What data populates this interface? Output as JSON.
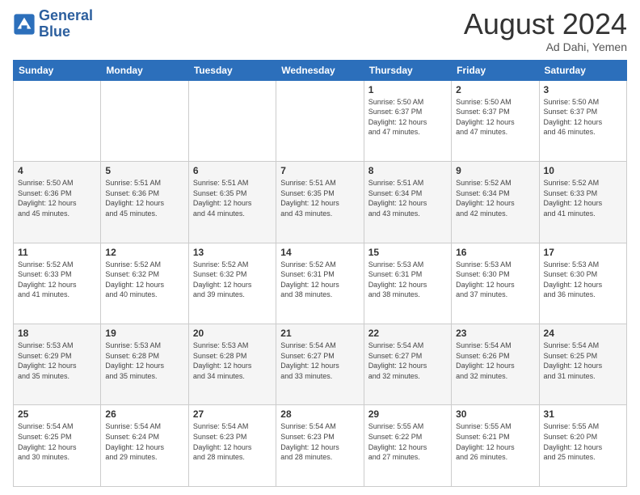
{
  "header": {
    "logo_line1": "General",
    "logo_line2": "Blue",
    "month_year": "August 2024",
    "location": "Ad Dahi, Yemen"
  },
  "days_of_week": [
    "Sunday",
    "Monday",
    "Tuesday",
    "Wednesday",
    "Thursday",
    "Friday",
    "Saturday"
  ],
  "weeks": [
    [
      {
        "day": "",
        "info": ""
      },
      {
        "day": "",
        "info": ""
      },
      {
        "day": "",
        "info": ""
      },
      {
        "day": "",
        "info": ""
      },
      {
        "day": "1",
        "info": "Sunrise: 5:50 AM\nSunset: 6:37 PM\nDaylight: 12 hours\nand 47 minutes."
      },
      {
        "day": "2",
        "info": "Sunrise: 5:50 AM\nSunset: 6:37 PM\nDaylight: 12 hours\nand 47 minutes."
      },
      {
        "day": "3",
        "info": "Sunrise: 5:50 AM\nSunset: 6:37 PM\nDaylight: 12 hours\nand 46 minutes."
      }
    ],
    [
      {
        "day": "4",
        "info": "Sunrise: 5:50 AM\nSunset: 6:36 PM\nDaylight: 12 hours\nand 45 minutes."
      },
      {
        "day": "5",
        "info": "Sunrise: 5:51 AM\nSunset: 6:36 PM\nDaylight: 12 hours\nand 45 minutes."
      },
      {
        "day": "6",
        "info": "Sunrise: 5:51 AM\nSunset: 6:35 PM\nDaylight: 12 hours\nand 44 minutes."
      },
      {
        "day": "7",
        "info": "Sunrise: 5:51 AM\nSunset: 6:35 PM\nDaylight: 12 hours\nand 43 minutes."
      },
      {
        "day": "8",
        "info": "Sunrise: 5:51 AM\nSunset: 6:34 PM\nDaylight: 12 hours\nand 43 minutes."
      },
      {
        "day": "9",
        "info": "Sunrise: 5:52 AM\nSunset: 6:34 PM\nDaylight: 12 hours\nand 42 minutes."
      },
      {
        "day": "10",
        "info": "Sunrise: 5:52 AM\nSunset: 6:33 PM\nDaylight: 12 hours\nand 41 minutes."
      }
    ],
    [
      {
        "day": "11",
        "info": "Sunrise: 5:52 AM\nSunset: 6:33 PM\nDaylight: 12 hours\nand 41 minutes."
      },
      {
        "day": "12",
        "info": "Sunrise: 5:52 AM\nSunset: 6:32 PM\nDaylight: 12 hours\nand 40 minutes."
      },
      {
        "day": "13",
        "info": "Sunrise: 5:52 AM\nSunset: 6:32 PM\nDaylight: 12 hours\nand 39 minutes."
      },
      {
        "day": "14",
        "info": "Sunrise: 5:52 AM\nSunset: 6:31 PM\nDaylight: 12 hours\nand 38 minutes."
      },
      {
        "day": "15",
        "info": "Sunrise: 5:53 AM\nSunset: 6:31 PM\nDaylight: 12 hours\nand 38 minutes."
      },
      {
        "day": "16",
        "info": "Sunrise: 5:53 AM\nSunset: 6:30 PM\nDaylight: 12 hours\nand 37 minutes."
      },
      {
        "day": "17",
        "info": "Sunrise: 5:53 AM\nSunset: 6:30 PM\nDaylight: 12 hours\nand 36 minutes."
      }
    ],
    [
      {
        "day": "18",
        "info": "Sunrise: 5:53 AM\nSunset: 6:29 PM\nDaylight: 12 hours\nand 35 minutes."
      },
      {
        "day": "19",
        "info": "Sunrise: 5:53 AM\nSunset: 6:28 PM\nDaylight: 12 hours\nand 35 minutes."
      },
      {
        "day": "20",
        "info": "Sunrise: 5:53 AM\nSunset: 6:28 PM\nDaylight: 12 hours\nand 34 minutes."
      },
      {
        "day": "21",
        "info": "Sunrise: 5:54 AM\nSunset: 6:27 PM\nDaylight: 12 hours\nand 33 minutes."
      },
      {
        "day": "22",
        "info": "Sunrise: 5:54 AM\nSunset: 6:27 PM\nDaylight: 12 hours\nand 32 minutes."
      },
      {
        "day": "23",
        "info": "Sunrise: 5:54 AM\nSunset: 6:26 PM\nDaylight: 12 hours\nand 32 minutes."
      },
      {
        "day": "24",
        "info": "Sunrise: 5:54 AM\nSunset: 6:25 PM\nDaylight: 12 hours\nand 31 minutes."
      }
    ],
    [
      {
        "day": "25",
        "info": "Sunrise: 5:54 AM\nSunset: 6:25 PM\nDaylight: 12 hours\nand 30 minutes."
      },
      {
        "day": "26",
        "info": "Sunrise: 5:54 AM\nSunset: 6:24 PM\nDaylight: 12 hours\nand 29 minutes."
      },
      {
        "day": "27",
        "info": "Sunrise: 5:54 AM\nSunset: 6:23 PM\nDaylight: 12 hours\nand 28 minutes."
      },
      {
        "day": "28",
        "info": "Sunrise: 5:54 AM\nSunset: 6:23 PM\nDaylight: 12 hours\nand 28 minutes."
      },
      {
        "day": "29",
        "info": "Sunrise: 5:55 AM\nSunset: 6:22 PM\nDaylight: 12 hours\nand 27 minutes."
      },
      {
        "day": "30",
        "info": "Sunrise: 5:55 AM\nSunset: 6:21 PM\nDaylight: 12 hours\nand 26 minutes."
      },
      {
        "day": "31",
        "info": "Sunrise: 5:55 AM\nSunset: 6:20 PM\nDaylight: 12 hours\nand 25 minutes."
      }
    ]
  ]
}
